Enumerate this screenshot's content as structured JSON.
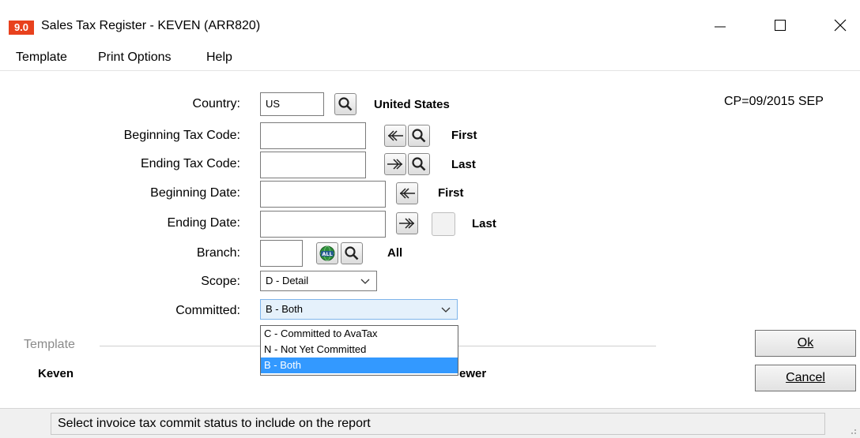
{
  "window": {
    "app_badge": "9.0",
    "title": "Sales Tax Register - KEVEN (ARR820)"
  },
  "menu": {
    "template": "Template",
    "print_options": "Print Options",
    "help": "Help"
  },
  "period": "CP=09/2015 SEP",
  "fields": {
    "country": {
      "label": "Country:",
      "value": "US",
      "desc": "United States"
    },
    "beginning_tax_code": {
      "label": "Beginning Tax Code:",
      "value": "",
      "desc": "First"
    },
    "ending_tax_code": {
      "label": "Ending Tax Code:",
      "value": "",
      "desc": "Last"
    },
    "beginning_date": {
      "label": "Beginning Date:",
      "value": "",
      "desc": "First"
    },
    "ending_date": {
      "label": "Ending Date:",
      "value": "",
      "desc": "Last"
    },
    "branch": {
      "label": "Branch:",
      "value": "",
      "desc": "All",
      "all_icon": "ALL"
    },
    "scope": {
      "label": "Scope:",
      "value": "D - Detail"
    },
    "committed": {
      "label": "Committed:",
      "value": "B - Both",
      "options": [
        "C - Committed to AvaTax",
        "N - Not Yet Committed",
        "B - Both"
      ],
      "selected_index": 2
    }
  },
  "template_group": {
    "label": "Template",
    "name": "Keven",
    "partial_hidden_text": "ewer"
  },
  "buttons": {
    "ok": "Ok",
    "cancel": "Cancel"
  },
  "status": "Select invoice tax commit status to include on the report",
  "colors": {
    "badge": "#e8411d",
    "selection": "#3399ff",
    "select_active_border": "#7eb4ea",
    "select_active_bg": "#e5f1fb"
  }
}
